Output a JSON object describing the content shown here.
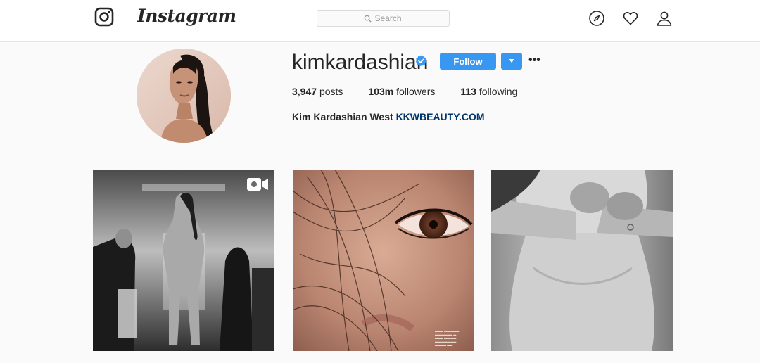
{
  "nav": {
    "wordmark": "Instagram",
    "search_placeholder": "Search",
    "icons": [
      "instagram-camera-icon",
      "search-icon",
      "explore-compass-icon",
      "activity-heart-icon",
      "profile-person-icon"
    ]
  },
  "profile": {
    "username": "kimkardashian",
    "verified": true,
    "follow_label": "Follow",
    "dropdown_icon": "caret-down-icon",
    "more_label": "•••",
    "stats": {
      "posts_count": "3,947",
      "posts_label": "posts",
      "followers_count": "103m",
      "followers_label": "followers",
      "following_count": "113",
      "following_label": "following"
    },
    "full_name": "Kim Kardashian West",
    "website": "KKWBEAUTY.COM"
  },
  "posts": [
    {
      "type": "video",
      "icon": "video-camera-icon"
    },
    {
      "type": "image"
    },
    {
      "type": "image"
    }
  ],
  "colors": {
    "accent": "#3897f0",
    "link": "#003569",
    "verified_badge": "#3897f0",
    "background": "#fafafa"
  }
}
